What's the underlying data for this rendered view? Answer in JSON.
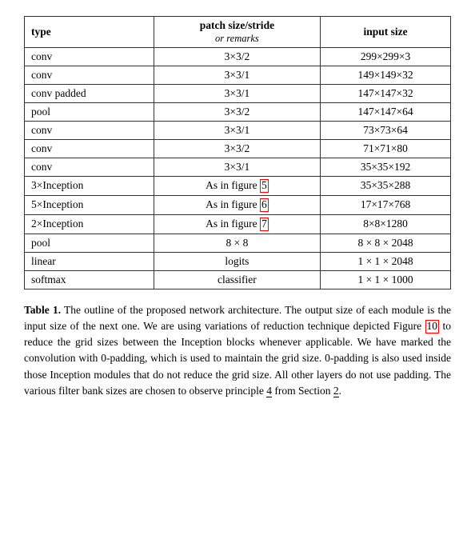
{
  "table": {
    "headers": {
      "type": "type",
      "patch": "patch size/stride",
      "patch_sub": "or remarks",
      "input": "input size"
    },
    "rows": [
      {
        "type": "conv",
        "patch": "3×3/2",
        "input": "299×299×3"
      },
      {
        "type": "conv",
        "patch": "3×3/1",
        "input": "149×149×32"
      },
      {
        "type": "conv padded",
        "patch": "3×3/1",
        "input": "147×147×32"
      },
      {
        "type": "pool",
        "patch": "3×3/2",
        "input": "147×147×64"
      },
      {
        "type": "conv",
        "patch": "3×3/1",
        "input": "73×73×64"
      },
      {
        "type": "conv",
        "patch": "3×3/2",
        "input": "71×71×80"
      },
      {
        "type": "conv",
        "patch": "3×3/1",
        "input": "35×35×192"
      },
      {
        "type": "3×Inception",
        "patch": "As in figure 5",
        "patch_ref": "5",
        "input": "35×35×288"
      },
      {
        "type": "5×Inception",
        "patch": "As in figure 6",
        "patch_ref": "6",
        "input": "17×17×768"
      },
      {
        "type": "2×Inception",
        "patch": "As in figure 7",
        "patch_ref": "7",
        "input": "8×8×1280"
      },
      {
        "type": "pool",
        "patch": "8 × 8",
        "input": "8 × 8 × 2048"
      },
      {
        "type": "linear",
        "patch": "logits",
        "input": "1 × 1 × 2048"
      },
      {
        "type": "softmax",
        "patch": "classifier",
        "input": "1 × 1 × 1000"
      }
    ]
  },
  "caption": {
    "title": "Table 1.",
    "text": " The outline of the proposed network architecture.  The output size of each module is the input size of the next one.  We are using variations of reduction technique depicted Figure ",
    "ref_10": "10",
    "text2": " to reduce the grid sizes between the Inception blocks whenever applicable.  We have marked the convolution with 0-padding, which is used to maintain the grid size.  0-padding is also used inside those Inception modules that do not reduce the grid size.  All other layers do not use padding.  The various filter bank sizes are chosen to observe principle ",
    "ref_4": "4",
    "text3": " from Section ",
    "ref_2": "2",
    "text4": "."
  }
}
